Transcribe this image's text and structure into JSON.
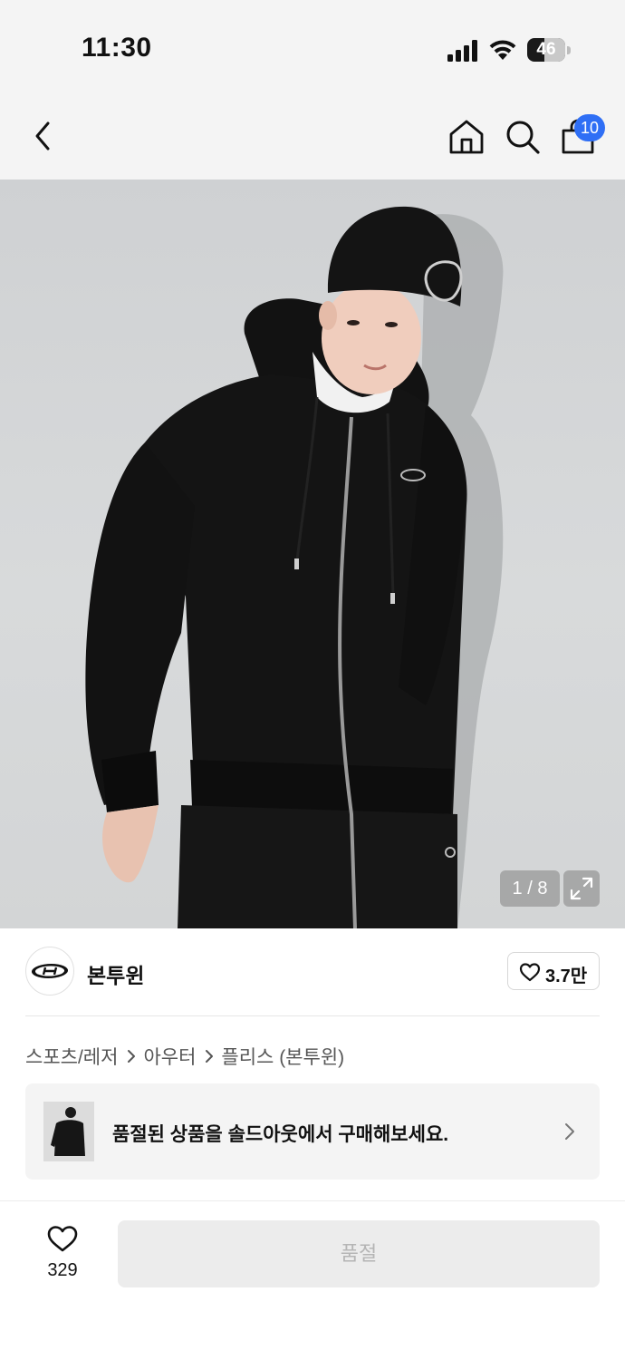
{
  "status_bar": {
    "time": "11:30",
    "battery_level": "46",
    "battery_percent": 46,
    "icons": [
      "signal-icon",
      "wifi-icon",
      "battery-icon"
    ]
  },
  "nav": {
    "icons": [
      "back-icon",
      "home-icon",
      "search-icon",
      "cart-icon"
    ],
    "cart_badge": "10",
    "badge_color": "#2f6ff5"
  },
  "gallery": {
    "counter": "1 / 8",
    "expand_icon": "expand-icon"
  },
  "brand": {
    "name": "본투윈",
    "like_count": "3.7만",
    "logo_icon": "brand-logo-icon"
  },
  "breadcrumb": {
    "items": [
      "스포츠/레저",
      "아우터",
      "플리스 (본투윈)"
    ]
  },
  "banner": {
    "text": "품절된 상품을 솔드아웃에서 구매해보세요.",
    "icon": "chevron-right-icon"
  },
  "bottom": {
    "like_count": "329",
    "button_label": "품절"
  }
}
